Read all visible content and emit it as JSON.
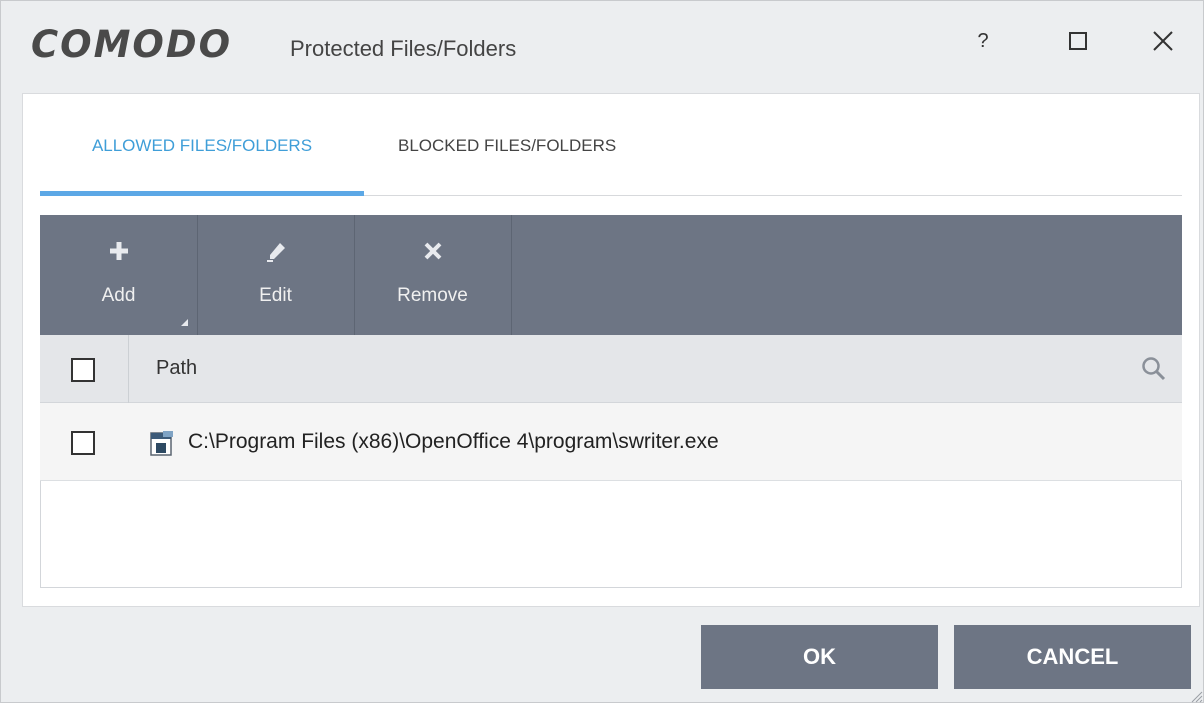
{
  "window": {
    "logo": "COMODO",
    "title": "Protected Files/Folders",
    "help_label": "?"
  },
  "tabs": [
    {
      "label": "ALLOWED FILES/FOLDERS",
      "active": true
    },
    {
      "label": "BLOCKED FILES/FOLDERS",
      "active": false
    }
  ],
  "toolbar": {
    "add_label": "Add",
    "edit_label": "Edit",
    "remove_label": "Remove"
  },
  "table": {
    "column_path": "Path",
    "rows": [
      {
        "path": "C:\\Program Files (x86)\\OpenOffice 4\\program\\swriter.exe",
        "icon": "file-exe-icon",
        "checked": false
      }
    ]
  },
  "footer": {
    "ok_label": "OK",
    "cancel_label": "CANCEL"
  },
  "colors": {
    "accent": "#5ca8e6",
    "toolbar_bg": "#6d7584",
    "button_bg": "#6d7584"
  }
}
